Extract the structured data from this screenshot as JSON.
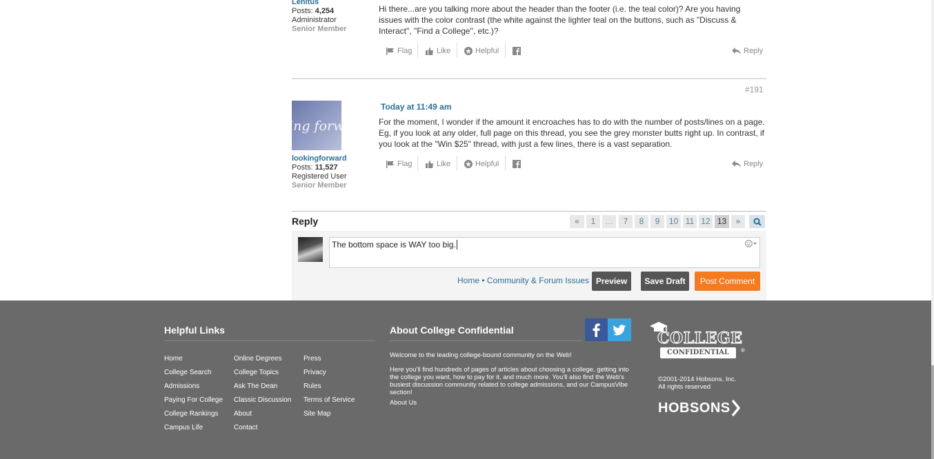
{
  "posts": [
    {
      "username": "Lenitus",
      "posts_label": "Posts:",
      "posts_count": "4,254",
      "role": "Administrator",
      "rank": "Senior Member",
      "body": "Hi there...are you talking more about the header than the footer (i.e. the teal color)? Are you having issues with the color contrast (the white against the lighter teal on the buttons, such as \"Discuss & Interact\", \"Find a College\", etc.)?",
      "actions": {
        "flag": "Flag",
        "like": "Like",
        "helpful": "Helpful",
        "reply": "Reply"
      }
    },
    {
      "number": "#191",
      "timestamp": "Today at 11:49 am",
      "username": "lookingforward",
      "avatar_text": "ing forw",
      "posts_label": "Posts:",
      "posts_count": "11,527",
      "role": "Registered User",
      "rank": "Senior Member",
      "body": "For the moment, I wonder if the amount it encroaches has to do with the number of posts/lines on a page. Eg, if you look at any older, full page on this thread, you see the grey monster butts right up. In contrast, if you look at the \"Win $25\" thread, with just a few lines, there is a vast separation.",
      "actions": {
        "flag": "Flag",
        "like": "Like",
        "helpful": "Helpful",
        "reply": "Reply"
      }
    }
  ],
  "reply": {
    "title": "Reply",
    "editor_value": "The bottom space is WAY too big.",
    "breadcrumb_home": "Home",
    "breadcrumb_sep": "•",
    "breadcrumb_section": "Community & Forum Issues",
    "preview": "Preview",
    "save_draft": "Save Draft",
    "post_comment": "Post Comment"
  },
  "pagination": {
    "prev": "«",
    "pages": [
      "1",
      "…",
      "7",
      "8",
      "9",
      "10",
      "11",
      "12",
      "13"
    ],
    "current": "13",
    "next": "»"
  },
  "footer": {
    "helpful_links_title": "Helpful Links",
    "col1": [
      "Home",
      "College Search",
      "Admissions",
      "Paying For College",
      "College Rankings",
      "Campus Life"
    ],
    "col2": [
      "Online Degrees",
      "College Topics",
      "Ask The Dean",
      "Classic Discussion",
      "About",
      "Contact"
    ],
    "col3": [
      "Press",
      "Privacy",
      "Rules",
      "Terms of Service",
      "Site Map"
    ],
    "about_title": "About College Confidential",
    "about_welcome": "Welcome to the leading college-bound community on the Web!",
    "about_text": "Here you'll find hundreds of pages of articles about choosing a college, getting into the college you want, how to pay for it, and much more. You'll also find the Web's busiest discussion community related to college admissions, and our CampusVibe section!",
    "about_link": "About Us",
    "logo_line1": "COLLEGE",
    "logo_line2": "CONFIDENTIAL",
    "copyright": "©2001-2014 Hobsons, Inc.",
    "rights": "All rights reserved",
    "hobsons": "HOBSONS"
  },
  "colors": {
    "link": "#2a6f97",
    "orange": "#f47b20",
    "footer_bg": "#6a6a6a",
    "facebook": "#3b5998",
    "twitter": "#3aa3dc"
  }
}
